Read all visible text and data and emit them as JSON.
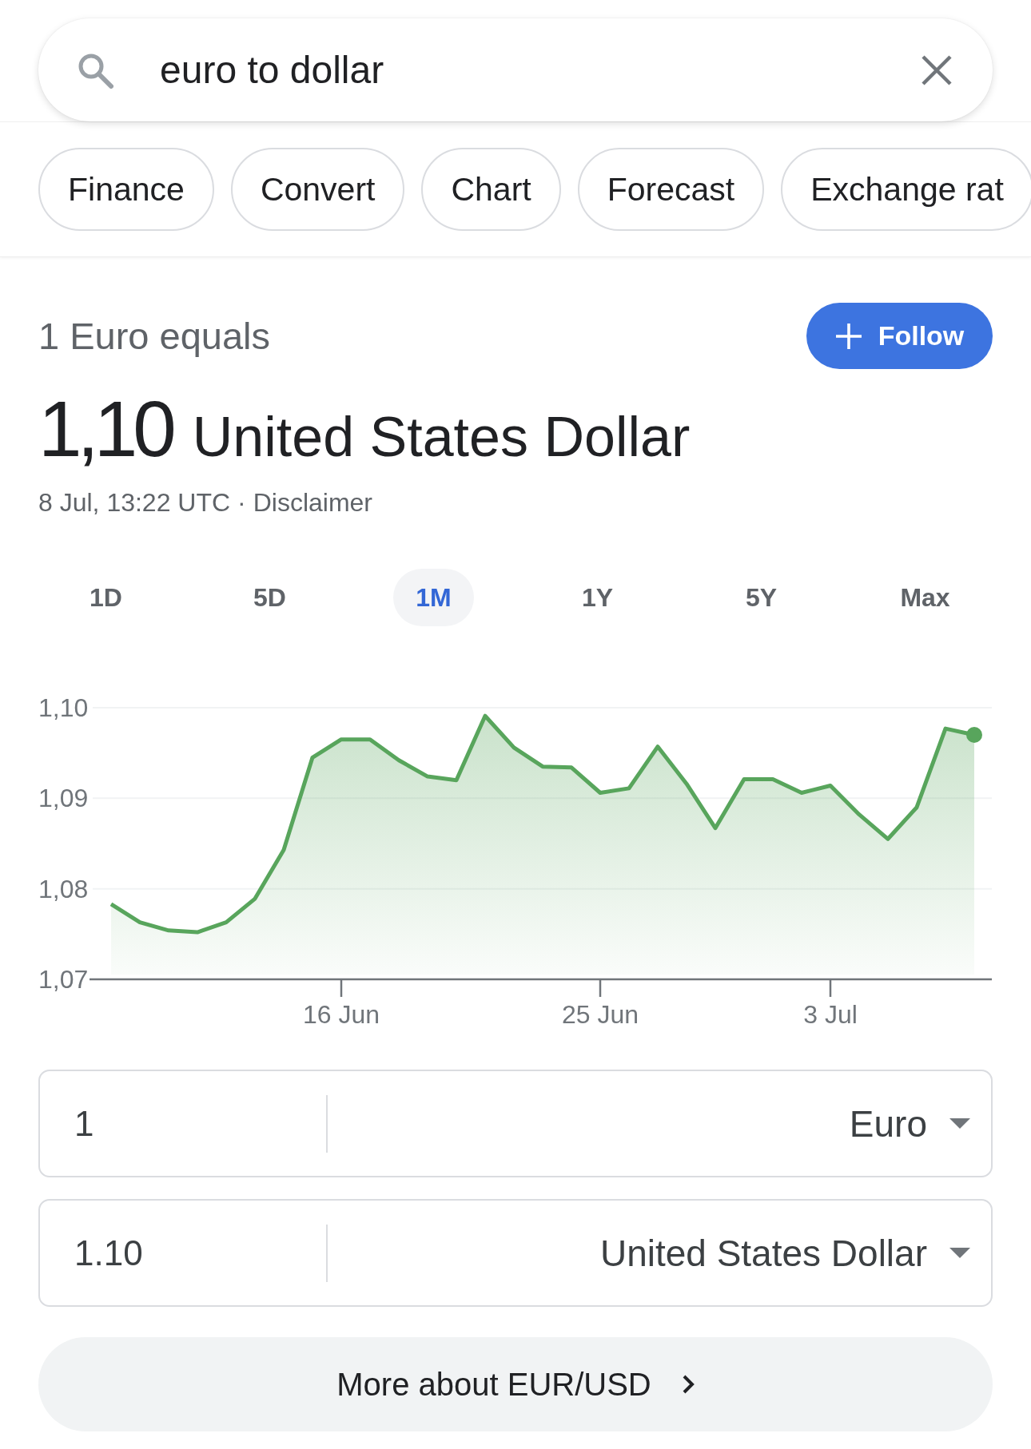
{
  "search": {
    "value": "euro to dollar"
  },
  "chips": [
    {
      "label": "Finance"
    },
    {
      "label": "Convert"
    },
    {
      "label": "Chart"
    },
    {
      "label": "Forecast"
    },
    {
      "label": "Exchange rat"
    }
  ],
  "summary": {
    "heading": "1 Euro equals",
    "amount": "1,10",
    "currency": "United States Dollar",
    "timestamp": "8 Jul, 13:22 UTC ·",
    "disclaimer": "Disclaimer"
  },
  "follow_button": {
    "label": "Follow"
  },
  "ranges": [
    {
      "label": "1D",
      "selected": false
    },
    {
      "label": "5D",
      "selected": false
    },
    {
      "label": "1M",
      "selected": true
    },
    {
      "label": "1Y",
      "selected": false
    },
    {
      "label": "5Y",
      "selected": false
    },
    {
      "label": "Max",
      "selected": false
    }
  ],
  "chart": {
    "chart_data": {
      "type": "area",
      "categories": [
        null,
        null,
        null,
        null,
        null,
        null,
        null,
        null,
        "16 Jun",
        null,
        null,
        null,
        null,
        null,
        null,
        null,
        null,
        "25 Jun",
        null,
        null,
        null,
        null,
        null,
        null,
        null,
        "3 Jul",
        null,
        null,
        null,
        null,
        null
      ],
      "series": [
        {
          "color": "#58a55c",
          "values": [
            1.0783,
            1.0763,
            1.0754,
            1.0752,
            1.0763,
            1.0789,
            1.0843,
            1.0945,
            1.0965,
            1.0965,
            1.0942,
            1.0924,
            1.092,
            1.0991,
            1.0956,
            1.0935,
            1.0934,
            1.0906,
            1.0911,
            1.0957,
            1.0916,
            1.0867,
            1.0921,
            1.0921,
            1.0906,
            1.0914,
            1.0882,
            1.0855,
            1.089,
            1.0977,
            1.097
          ]
        }
      ],
      "ylim": [
        1.07,
        1.1
      ],
      "yticks": [
        {
          "value": 1.1,
          "label": "1,10"
        },
        {
          "value": 1.09,
          "label": "1,09"
        },
        {
          "value": 1.08,
          "label": "1,08"
        },
        {
          "value": 1.07,
          "label": "1,07"
        }
      ]
    }
  },
  "converter": [
    {
      "amount": "1",
      "currency": "Euro"
    },
    {
      "amount": "1.10",
      "currency": "United States Dollar"
    }
  ],
  "more_button": {
    "label": "More about EUR/USD"
  }
}
